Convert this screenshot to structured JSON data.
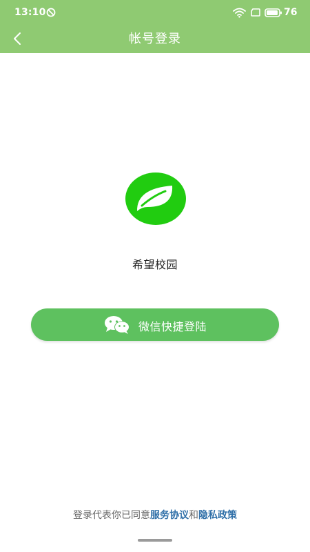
{
  "status_bar": {
    "time": "13:10",
    "battery": "76",
    "icons": [
      "do-not-disturb-icon",
      "wifi-icon",
      "sim-icon",
      "battery-icon"
    ]
  },
  "header": {
    "title": "帐号登录",
    "back_icon": "chevron-left-icon",
    "background_color": "#8fca72"
  },
  "main": {
    "logo_icon": "leaf-icon",
    "logo_color": "#21cc10",
    "app_name": "希望校园",
    "wechat_button": {
      "label": "微信快捷登陆",
      "icon": "wechat-icon",
      "color": "#5ec15f"
    }
  },
  "footer": {
    "agreement_prefix": "登录代表你已同意",
    "terms_link": "服务协议",
    "connector": "和",
    "privacy_link": "隐私政策",
    "link_color": "#2f6fa8"
  }
}
